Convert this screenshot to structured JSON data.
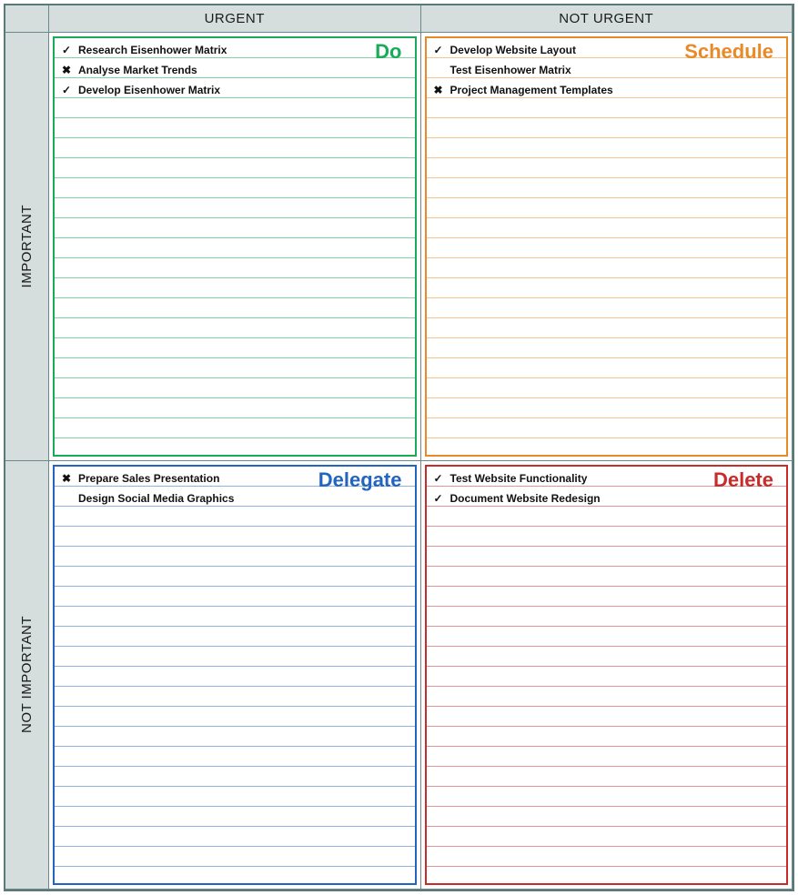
{
  "headers": {
    "col_urgent": "URGENT",
    "col_not_urgent": "NOT URGENT",
    "row_important": "IMPORTANT",
    "row_not_important": "NOT IMPORTANT"
  },
  "quadrants": {
    "do": {
      "label": "Do",
      "color": "#1aab5a",
      "tasks": [
        {
          "status": "check",
          "text": "Research Eisenhower Matrix"
        },
        {
          "status": "x",
          "text": "Analyse Market Trends"
        },
        {
          "status": "check",
          "text": "Develop Eisenhower Matrix"
        }
      ]
    },
    "schedule": {
      "label": "Schedule",
      "color": "#e88a2a",
      "tasks": [
        {
          "status": "check",
          "text": "Develop Website Layout"
        },
        {
          "status": "",
          "text": "Test Eisenhower Matrix"
        },
        {
          "status": "x",
          "text": "Project Management Templates"
        }
      ]
    },
    "delegate": {
      "label": "Delegate",
      "color": "#2265c0",
      "tasks": [
        {
          "status": "x",
          "text": "Prepare Sales Presentation"
        },
        {
          "status": "",
          "text": "Design Social Media Graphics"
        }
      ]
    },
    "delete": {
      "label": "Delete",
      "color": "#c92a2a",
      "tasks": [
        {
          "status": "check",
          "text": "Test Website Functionality"
        },
        {
          "status": "check",
          "text": "Document Website Redesign"
        }
      ]
    }
  }
}
